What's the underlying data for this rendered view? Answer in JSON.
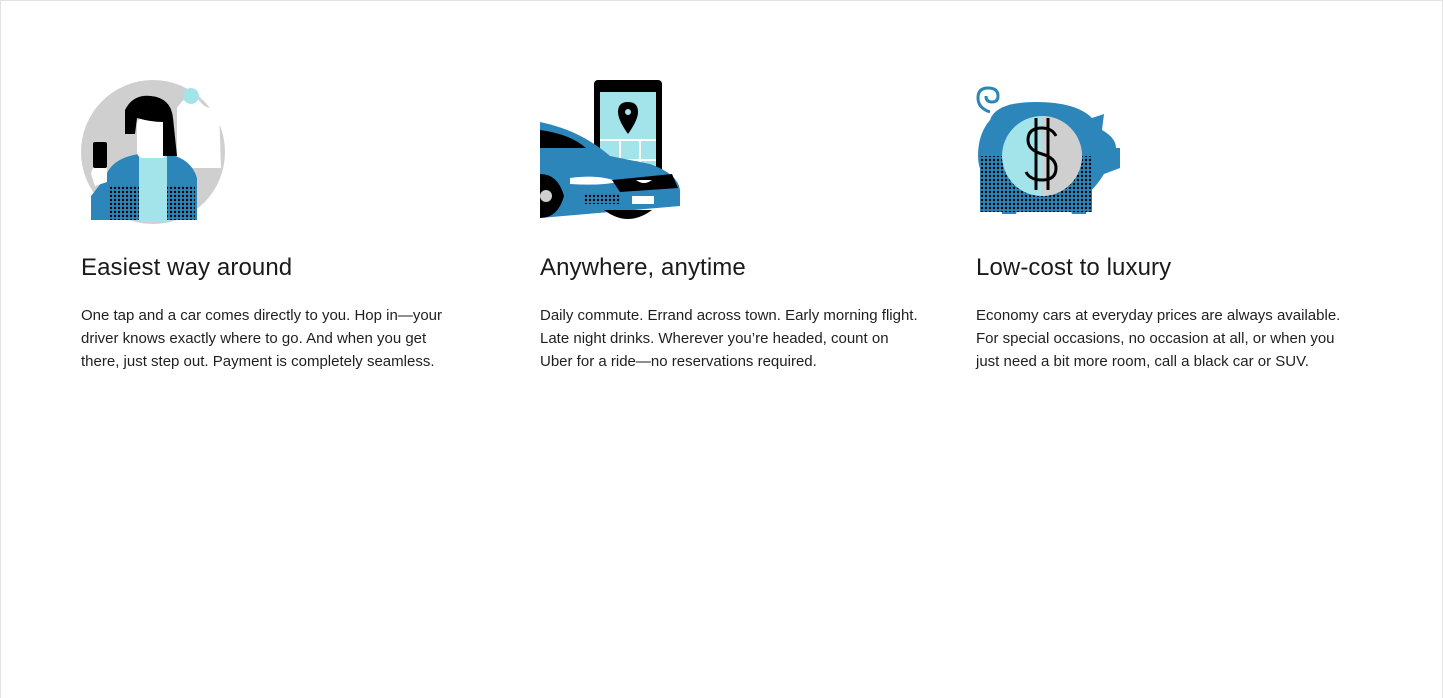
{
  "features": [
    {
      "icon": "rider-with-phone-illustration",
      "title": "Easiest way around",
      "text": "One tap and a car comes directly to you. Hop in—your driver knows exactly where to go. And when you get there, just step out. Payment is completely seamless."
    },
    {
      "icon": "car-and-phone-map-illustration",
      "title": "Anywhere, anytime",
      "text": "Daily commute. Errand across town. Early morning flight. Late night drinks. Wherever you’re headed, count on Uber for a ride—no reservations required."
    },
    {
      "icon": "piggy-bank-dollar-illustration",
      "title": "Low-cost to luxury",
      "text": "Economy cars at everyday prices are always available. For special occasions, no occasion at all, or when you just need a bit more room, call a black car or SUV."
    }
  ],
  "colors": {
    "blue": "#2c86ba",
    "light_cyan": "#a3e4ea",
    "grey": "#cfcfcf",
    "black": "#000000"
  }
}
